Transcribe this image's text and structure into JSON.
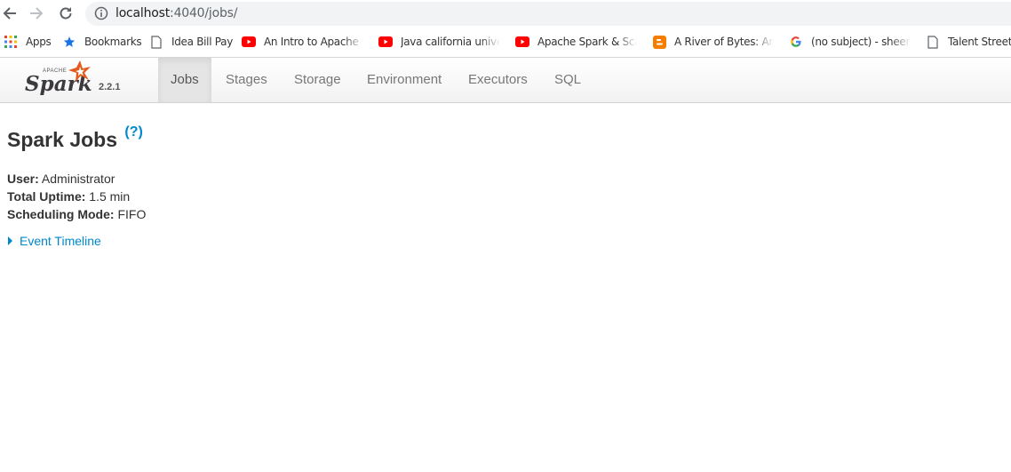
{
  "browser": {
    "url_host": "localhost",
    "url_path": ":4040/jobs/",
    "bookmarks": [
      {
        "label": "Apps",
        "icon": "apps-grid-icon"
      },
      {
        "label": "Bookmarks",
        "icon": "star-icon"
      },
      {
        "label": "Idea Bill Pay",
        "icon": "page-icon"
      },
      {
        "label": "An Intro to Apache Sp",
        "icon": "youtube-icon"
      },
      {
        "label": "Java california univer",
        "icon": "youtube-icon"
      },
      {
        "label": "Apache Spark & Scala",
        "icon": "youtube-icon"
      },
      {
        "label": "A River of Bytes: An e",
        "icon": "blogger-icon"
      },
      {
        "label": "(no subject) - sheena",
        "icon": "google-icon"
      },
      {
        "label": "Talent Street -",
        "icon": "page-icon"
      }
    ]
  },
  "spark": {
    "logo_top": "APACHE",
    "logo_text": "Spark",
    "version": "2.2.1",
    "tabs": [
      {
        "label": "Jobs",
        "active": true
      },
      {
        "label": "Stages",
        "active": false
      },
      {
        "label": "Storage",
        "active": false
      },
      {
        "label": "Environment",
        "active": false
      },
      {
        "label": "Executors",
        "active": false
      },
      {
        "label": "SQL",
        "active": false
      }
    ]
  },
  "page": {
    "title": "Spark Jobs",
    "help": "(?)",
    "user_label": "User:",
    "user_value": "Administrator",
    "uptime_label": "Total Uptime:",
    "uptime_value": "1.5 min",
    "mode_label": "Scheduling Mode:",
    "mode_value": "FIFO",
    "timeline_link": "Event Timeline"
  },
  "colors": {
    "link": "#0088cc",
    "spark_orange": "#e25a1c"
  }
}
